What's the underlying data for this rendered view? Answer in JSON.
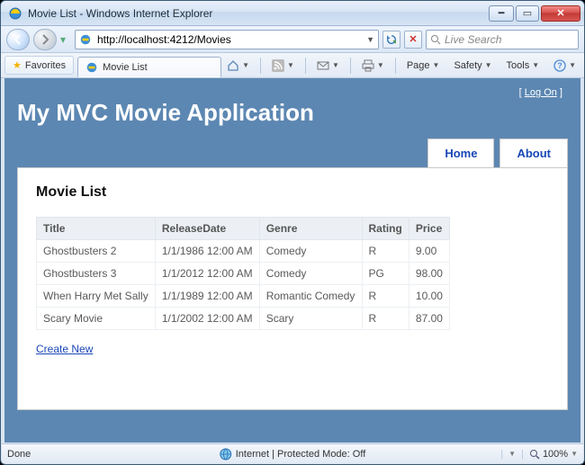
{
  "window": {
    "title": "Movie List - Windows Internet Explorer"
  },
  "address": {
    "url": "http://localhost:4212/Movies"
  },
  "search": {
    "placeholder": "Live Search"
  },
  "favbar": {
    "favorites_label": "Favorites",
    "tab_label": "Movie List"
  },
  "toolbar": {
    "page": "Page",
    "safety": "Safety",
    "tools": "Tools"
  },
  "status": {
    "left": "Done",
    "center": "Internet | Protected Mode: Off",
    "zoom": "100%"
  },
  "app": {
    "logon": "Log On",
    "title": "My MVC Movie Application",
    "nav": {
      "home": "Home",
      "about": "About"
    },
    "heading": "Movie List",
    "columns": [
      "Title",
      "ReleaseDate",
      "Genre",
      "Rating",
      "Price"
    ],
    "rows": [
      {
        "title": "Ghostbusters 2",
        "date": "1/1/1986 12:00 AM",
        "genre": "Comedy",
        "rating": "R",
        "price": "9.00"
      },
      {
        "title": "Ghostbusters 3",
        "date": "1/1/2012 12:00 AM",
        "genre": "Comedy",
        "rating": "PG",
        "price": "98.00"
      },
      {
        "title": "When Harry Met Sally",
        "date": "1/1/1989 12:00 AM",
        "genre": "Romantic Comedy",
        "rating": "R",
        "price": "10.00"
      },
      {
        "title": "Scary Movie",
        "date": "1/1/2002 12:00 AM",
        "genre": "Scary",
        "rating": "R",
        "price": "87.00"
      }
    ],
    "create": "Create New"
  }
}
